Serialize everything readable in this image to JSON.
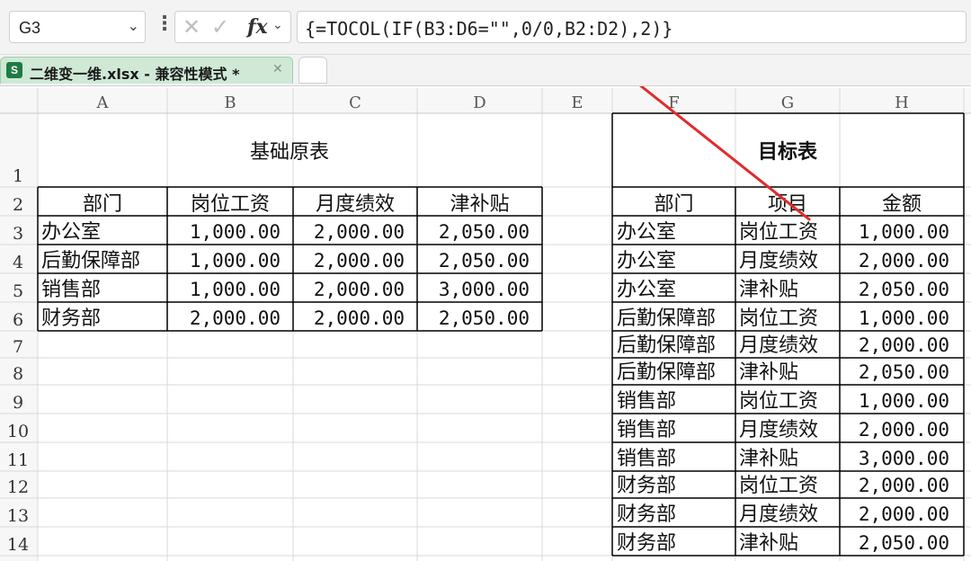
{
  "formula_bar": {
    "name_box": "G3",
    "fx_label": "fx",
    "formula": "{=TOCOL(IF(B3:D6=\"\",0/0,B2:D2),2)}"
  },
  "tab": {
    "title": "二维变一维.xlsx - 兼容性模式 *"
  },
  "columns": [
    "A",
    "B",
    "C",
    "D",
    "E",
    "F",
    "G",
    "H"
  ],
  "rows": [
    "1",
    "2",
    "3",
    "4",
    "5",
    "6",
    "7",
    "8",
    "9",
    "10",
    "11",
    "12",
    "13",
    "14"
  ],
  "source_table": {
    "title": "基础原表",
    "headers": [
      "部门",
      "岗位工资",
      "月度绩效",
      "津补贴"
    ],
    "rows": [
      [
        "办公室",
        "1,000.00",
        "2,000.00",
        "2,050.00"
      ],
      [
        "后勤保障部",
        "1,000.00",
        "2,000.00",
        "2,050.00"
      ],
      [
        "销售部",
        "1,000.00",
        "2,000.00",
        "3,000.00"
      ],
      [
        "财务部",
        "2,000.00",
        "2,000.00",
        "2,050.00"
      ]
    ]
  },
  "target_table": {
    "title": "目标表",
    "headers": [
      "部门",
      "项目",
      "金额"
    ],
    "rows": [
      [
        "办公室",
        "岗位工资",
        "1,000.00"
      ],
      [
        "办公室",
        "月度绩效",
        "2,000.00"
      ],
      [
        "办公室",
        "津补贴",
        "2,050.00"
      ],
      [
        "后勤保障部",
        "岗位工资",
        "1,000.00"
      ],
      [
        "后勤保障部",
        "月度绩效",
        "2,000.00"
      ],
      [
        "后勤保障部",
        "津补贴",
        "2,050.00"
      ],
      [
        "销售部",
        "岗位工资",
        "1,000.00"
      ],
      [
        "销售部",
        "月度绩效",
        "2,000.00"
      ],
      [
        "销售部",
        "津补贴",
        "3,000.00"
      ],
      [
        "财务部",
        "岗位工资",
        "2,000.00"
      ],
      [
        "财务部",
        "月度绩效",
        "2,000.00"
      ],
      [
        "财务部",
        "津补贴",
        "2,050.00"
      ]
    ]
  },
  "colors": {
    "grid_line": "#d9d9d9",
    "border": "#000000",
    "arrow": "#e02c2c",
    "header_text": "#555555",
    "tab_active": "#cfe9d6"
  }
}
